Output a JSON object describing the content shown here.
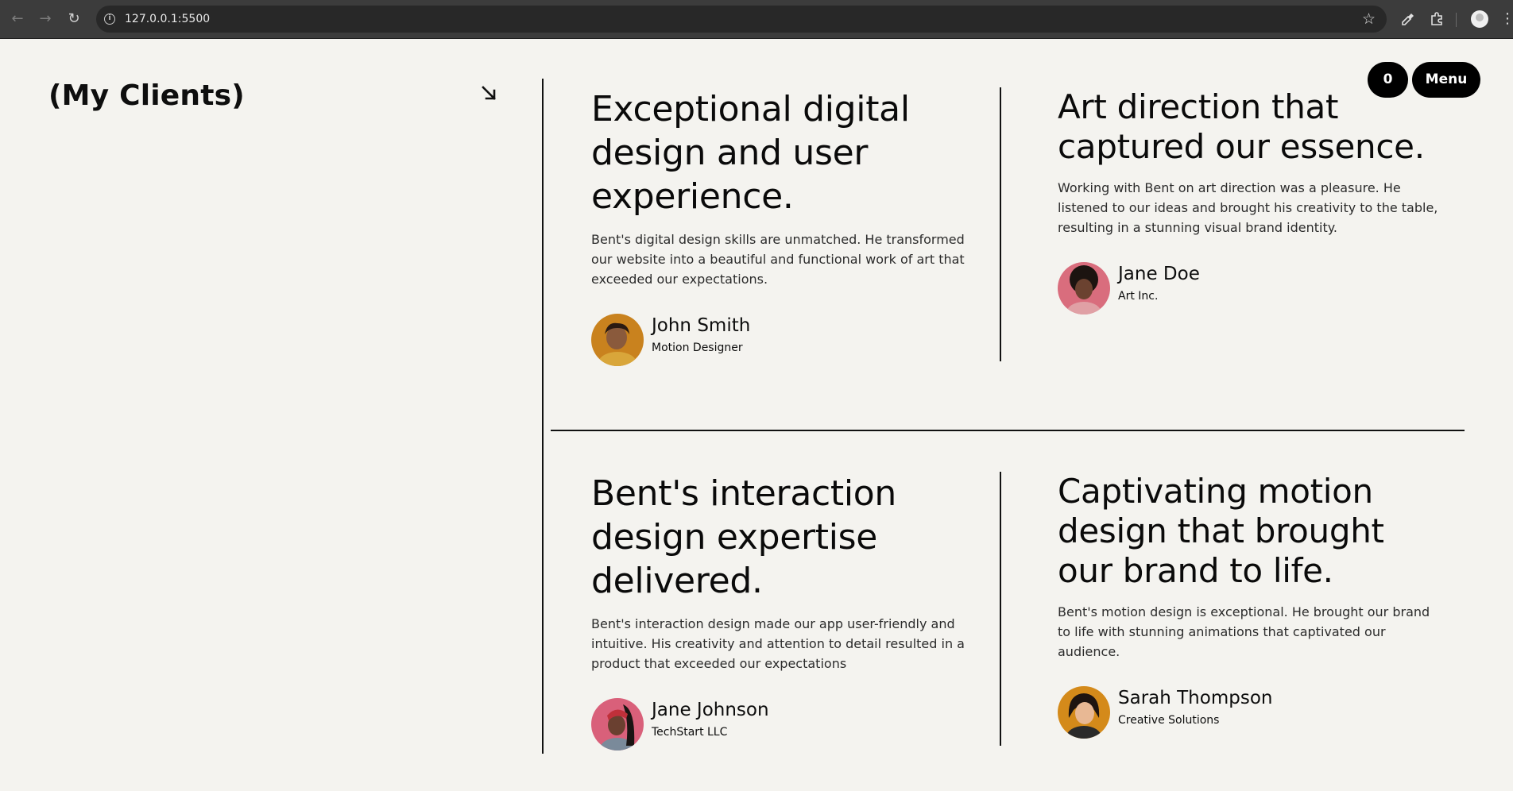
{
  "browser": {
    "url": "127.0.0.1:5500",
    "icons": {
      "back": "arrow-left-icon",
      "forward": "arrow-right-icon",
      "reload": "reload-icon",
      "site_info": "info-icon",
      "bookmark": "star-icon",
      "eyedropper": "eyedropper-icon",
      "extensions": "puzzle-icon",
      "profile": "profile-icon",
      "more": "kebab-icon"
    }
  },
  "header": {
    "section_title": "(My Clients)",
    "counter_label": "0",
    "menu_label": "Menu"
  },
  "colors": {
    "background": "#f4f3ef",
    "text": "#0a0a0a",
    "button_bg": "#000000",
    "button_text": "#ffffff"
  },
  "testimonials": [
    {
      "headline": "Exceptional digital design and user experience.",
      "quote": "Bent's digital design skills are unmatched. He transformed our website into a beautiful and functional work of art that exceeded our expectations.",
      "name": "John Smith",
      "role": "Motion Designer"
    },
    {
      "headline": "Art direction that captured our essence.",
      "quote": "Working with Bent on art direction was a pleasure. He listened to our ideas and brought his creativity to the table, resulting in a stunning visual brand identity.",
      "name": "Jane Doe",
      "role": "Art Inc."
    },
    {
      "headline": "Bent's interaction design expertise delivered.",
      "quote": "Bent's interaction design made our app user-friendly and intuitive. His creativity and attention to detail resulted in a product that exceeded our expectations",
      "name": "Jane Johnson",
      "role": "TechStart LLC"
    },
    {
      "headline": "Captivating motion design that brought our brand to life.",
      "quote": "Bent's motion design is exceptional. He brought our brand to life with stunning animations that captivated our audience.",
      "name": "Sarah Thompson",
      "role": "Creative Solutions"
    }
  ]
}
